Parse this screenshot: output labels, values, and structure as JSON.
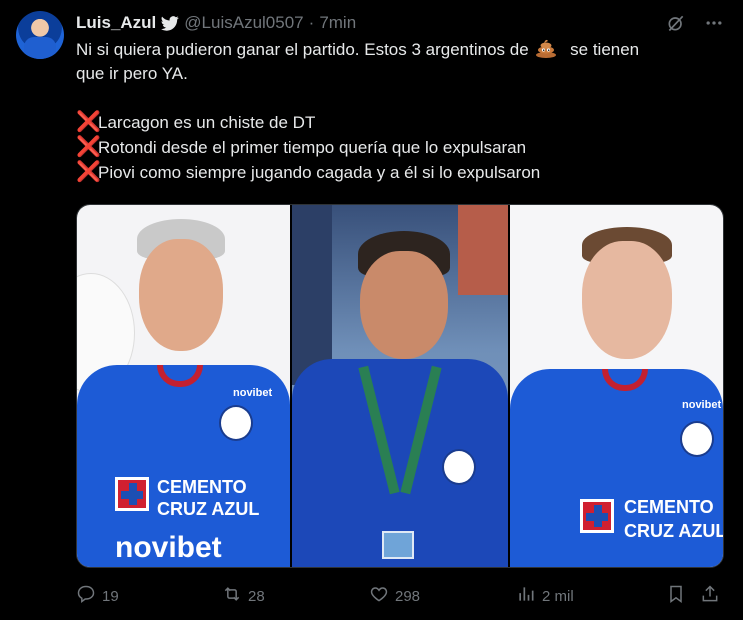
{
  "tweet": {
    "author": {
      "name": "Luis_Azul",
      "handle": "@LuisAzul0507",
      "separator": "·",
      "time": "7min"
    },
    "text": {
      "line1_before_emoji": "Ni si quiera pudieron ganar el partido. Estos 3 argentinos de",
      "line1_after_emoji": "se tienen",
      "line2": "que ir pero YA.",
      "bullets": [
        "Larcagon es un chiste de DT",
        "Rotondi desde el primer tiempo quería que lo expulsaran",
        "Piovi como siempre jugando cagada y a él si lo expulsaron"
      ],
      "bullet_mark": "❌"
    },
    "media": {
      "photo1": {
        "sponsor_small": "novibet",
        "brand_top": "CEMENTO",
        "brand_bottom": "CRUZ AZUL",
        "sponsor_big": "novibet"
      },
      "photo3": {
        "sponsor_small": "novibet",
        "brand_top": "CEMENTO",
        "brand_bottom": "CRUZ AZUL"
      }
    },
    "stats": {
      "replies": "19",
      "retweets": "28",
      "likes": "298",
      "views": "2 mil"
    }
  },
  "colors": {
    "background": "#000000",
    "text": "#e7e9ea",
    "muted": "#71767b",
    "x_mark": "#f4212e",
    "jersey_blue": "#1d5bd6"
  },
  "icons": {
    "verified": "bird-icon",
    "grok": "grok-icon",
    "more": "more-icon",
    "emoji": "poop-icon",
    "reply": "reply-icon",
    "retweet": "retweet-icon",
    "like": "heart-icon",
    "views": "views-icon",
    "bookmark": "bookmark-icon",
    "share": "share-icon"
  }
}
